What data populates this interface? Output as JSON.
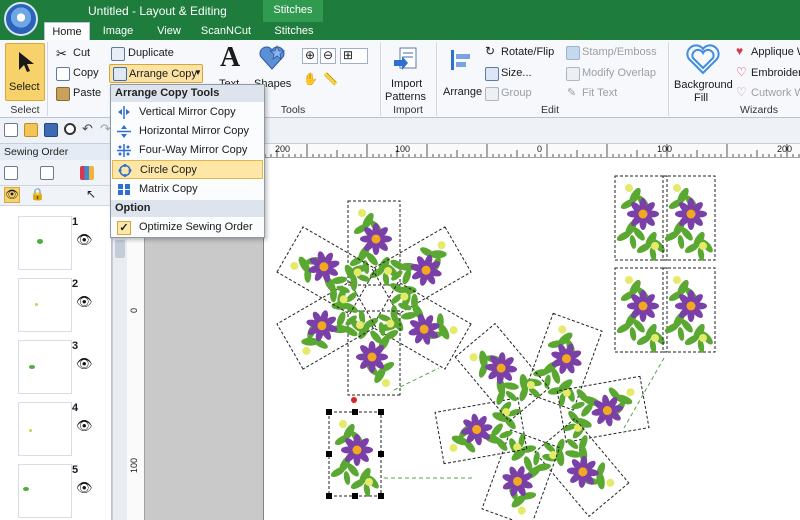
{
  "window": {
    "title": "Untitled - Layout & Editing",
    "context_tab_group": "Stitches"
  },
  "tabs": [
    {
      "label": "Home",
      "active": true
    },
    {
      "label": "Image",
      "active": false
    },
    {
      "label": "View",
      "active": false
    },
    {
      "label": "ScanNCut",
      "active": false
    },
    {
      "label": "Stitches",
      "active": false
    }
  ],
  "ribbon": {
    "select": {
      "button": "Select",
      "group": "Select"
    },
    "clipboard": {
      "cut": "Cut",
      "copy": "Copy",
      "paste": "Paste",
      "duplicate": "Duplicate",
      "arrange_copy": "Arrange Copy"
    },
    "text_shapes": {
      "text": "Text",
      "shapes": "Shapes",
      "tools_group": "Tools"
    },
    "import": {
      "button_line1": "Import",
      "button_line2": "Patterns",
      "group": "Import"
    },
    "edit": {
      "arrange": "Arrange",
      "rotate_flip": "Rotate/Flip",
      "size": "Size...",
      "group_btn": "Group",
      "stamp_emboss": "Stamp/Emboss",
      "modify_overlap": "Modify Overlap",
      "fit_text": "Fit Text",
      "group": "Edit"
    },
    "wizards": {
      "background_fill_line1": "Background",
      "background_fill_line2": "Fill",
      "applique": "Applique W",
      "embroidery": "Embroider",
      "cutwork": "Cutwork W",
      "group": "Wizards"
    }
  },
  "sewing_order": {
    "title": "Sewing Order",
    "items": [
      "1",
      "2",
      "3",
      "4",
      "5"
    ]
  },
  "ruler": {
    "top": [
      "200",
      "100",
      "0",
      "100",
      "200"
    ],
    "left": [
      "0",
      "100"
    ]
  },
  "dropdown": {
    "header": "Arrange Copy Tools",
    "items": [
      {
        "label": "Vertical Mirror Copy",
        "icon": "vertical-mirror-icon"
      },
      {
        "label": "Horizontal Mirror Copy",
        "icon": "horizontal-mirror-icon"
      },
      {
        "label": "Four-Way Mirror Copy",
        "icon": "four-way-mirror-icon"
      },
      {
        "label": "Circle Copy",
        "icon": "circle-copy-icon",
        "highlighted": true
      },
      {
        "label": "Matrix Copy",
        "icon": "matrix-copy-icon"
      }
    ],
    "option_header": "Option",
    "option_item": {
      "label": "Optimize Sewing Order",
      "checked": true,
      "check": "✓"
    }
  },
  "colors": {
    "title_green": "#1e7d3c",
    "flower_purple": "#7b3fa8",
    "flower_center": "#f2a91f",
    "leaf_green": "#5aa832",
    "highlight": "#fde6a6"
  }
}
